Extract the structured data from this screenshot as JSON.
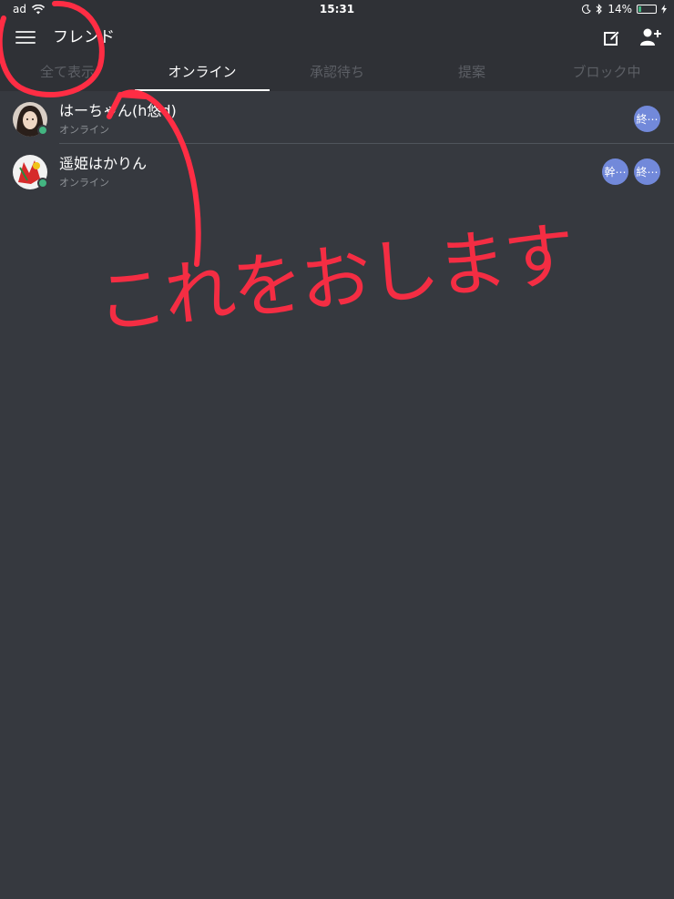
{
  "status_bar": {
    "carrier": "ad",
    "time": "15:31",
    "battery": "14%",
    "battery_level": 0.14
  },
  "header": {
    "title": "フレンド",
    "tabs": [
      {
        "label": "全て表示",
        "active": false
      },
      {
        "label": "オンライン",
        "active": true
      },
      {
        "label": "承認待ち",
        "active": false
      },
      {
        "label": "提案",
        "active": false
      },
      {
        "label": "ブロック中",
        "active": false
      }
    ]
  },
  "friends": [
    {
      "name": "はーちゃん(h悠d)",
      "status": "オンライン",
      "badges": [
        "終⋯"
      ]
    },
    {
      "name": "遥姫はかりん",
      "status": "オンライン",
      "badges": [
        "幹⋯",
        "終⋯"
      ]
    }
  ],
  "annotation": {
    "text": "これをおします",
    "color": "#ff2d44"
  },
  "colors": {
    "background": "#36393f",
    "header": "#2f3136",
    "online": "#43b581",
    "badge": "#7289da"
  }
}
